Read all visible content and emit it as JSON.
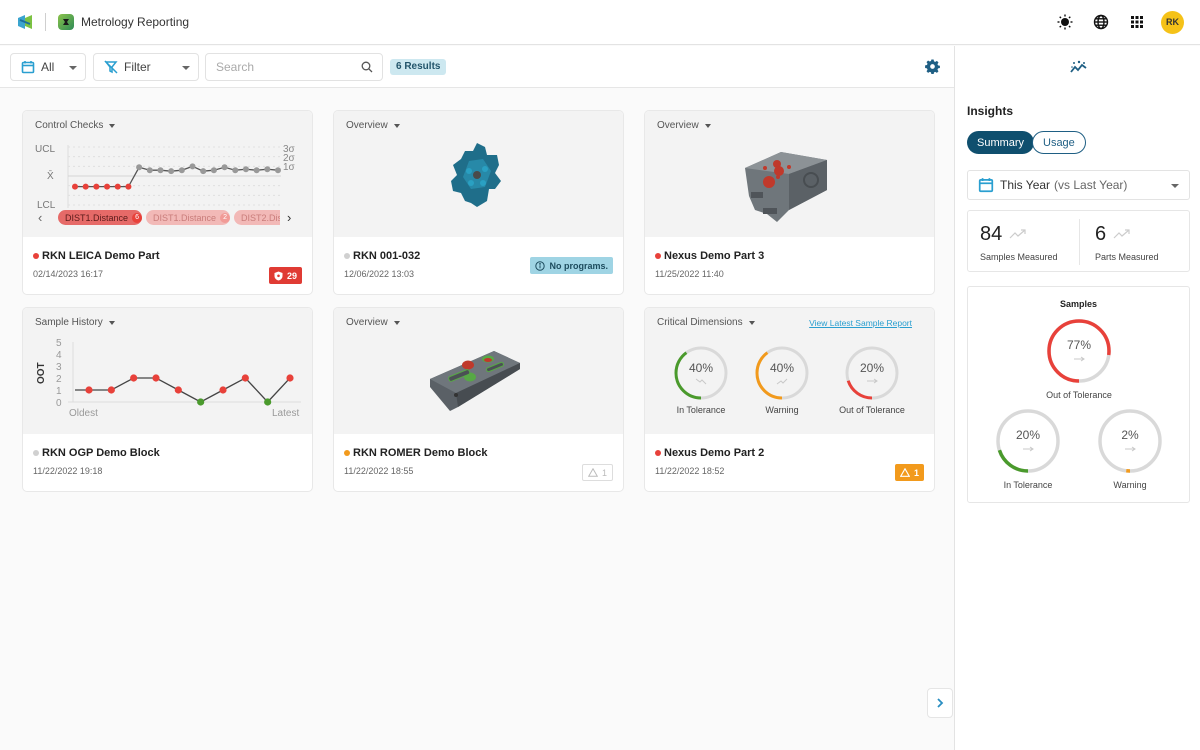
{
  "header": {
    "app_title": "Metrology Reporting",
    "avatar_initials": "RK",
    "icons": [
      "brand-logo-icon",
      "app-icon",
      "theme-sun-icon",
      "globe-icon",
      "apps-grid-icon"
    ]
  },
  "toolbar": {
    "date_filter": "All",
    "filter_label": "Filter",
    "search_placeholder": "Search",
    "search_value": "",
    "results_label": "6 Results"
  },
  "cards": [
    {
      "view": "Control Checks",
      "name": "RKN LEICA Demo Part",
      "status_color": "#e8413a",
      "date": "02/14/2023 16:17",
      "badge": {
        "type": "alert",
        "count": "29",
        "bg": "#e03b34",
        "color": "#ffffff"
      },
      "chart": {
        "y_labels_left": [
          "UCL",
          "X̄",
          "LCL"
        ],
        "y_labels_right": [
          "3σ",
          "2σ",
          "1σ"
        ],
        "chips": [
          {
            "label": "DIST1.Distance",
            "count": "6"
          },
          {
            "label": "DIST1.Distance",
            "count": "2"
          },
          {
            "label": "DIST2.Dis",
            "count": ""
          }
        ]
      }
    },
    {
      "view": "Overview",
      "name": "RKN 001-032",
      "status_color": "#cccccc",
      "date": "12/06/2022 13:03",
      "badge": {
        "type": "info",
        "text": "No programs."
      }
    },
    {
      "view": "Overview",
      "name": "Nexus Demo Part 3",
      "status_color": "#e8413a",
      "date": "11/25/2022 11:40"
    },
    {
      "view": "Sample History",
      "name": "RKN OGP Demo Block",
      "status_color": "#cccccc",
      "date": "11/22/2022 19:18",
      "chart": {
        "ylabel": "OOT",
        "y_ticks": [
          "0",
          "1",
          "2",
          "3",
          "4",
          "5"
        ],
        "x_start": "Oldest",
        "x_end": "Latest"
      }
    },
    {
      "view": "Overview",
      "name": "RKN ROMER Demo Block",
      "status_color": "#f29a1c",
      "date": "11/22/2022 18:55",
      "badge": {
        "type": "warning-outline",
        "count": "1"
      }
    },
    {
      "view": "Critical Dimensions",
      "link": "View Latest Sample Report",
      "name": "Nexus Demo Part 2",
      "status_color": "#e8413a",
      "date": "11/22/2022 18:52",
      "badge": {
        "type": "warning",
        "count": "1",
        "bg": "#f29a1c"
      },
      "gauges": [
        {
          "label": "In Tolerance",
          "value": "40%",
          "fraction": 0.4,
          "color": "#4a9a2c",
          "trend": "down"
        },
        {
          "label": "Warning",
          "value": "40%",
          "fraction": 0.4,
          "color": "#f29a1c",
          "trend": "up"
        },
        {
          "label": "Out of Tolerance",
          "value": "20%",
          "fraction": 0.2,
          "color": "#e8413a",
          "trend": "flat"
        }
      ]
    }
  ],
  "insights": {
    "title": "Insights",
    "tabs": [
      "Summary",
      "Usage"
    ],
    "active_tab": "Summary",
    "period": "This Year",
    "period_compare": "(vs Last Year)",
    "stats": [
      {
        "value": "84",
        "label": "Samples Measured"
      },
      {
        "value": "6",
        "label": "Parts Measured"
      }
    ],
    "samples_title": "Samples",
    "rings": [
      {
        "label": "Out of Tolerance",
        "value": "77%",
        "fraction": 0.77,
        "color": "#e8413a"
      },
      {
        "label": "In Tolerance",
        "value": "20%",
        "fraction": 0.2,
        "color": "#4a9a2c"
      },
      {
        "label": "Warning",
        "value": "2%",
        "fraction": 0.02,
        "color": "#f29a1c"
      }
    ]
  },
  "chart_data": [
    {
      "type": "line",
      "title": "Control Checks",
      "ylabels": [
        "LCL",
        "X̄",
        "UCL"
      ],
      "sigma_labels": [
        "1σ",
        "2σ",
        "3σ"
      ],
      "series": [
        {
          "name": "DIST1.Distance",
          "values": [
            -1.1,
            -1.1,
            -1.1,
            -1.1,
            -1.1,
            -1.1,
            0.9,
            0.6,
            0.6,
            0.5,
            0.6,
            1.0,
            0.5,
            0.6,
            0.9,
            0.6,
            0.7,
            0.6,
            0.7,
            0.6
          ],
          "out_of_control_points": 6
        }
      ],
      "ylim_sigma": [
        -3,
        3
      ]
    },
    {
      "type": "line",
      "title": "Sample History",
      "ylabel": "OOT",
      "xlabel_start": "Oldest",
      "xlabel_end": "Latest",
      "ylim": [
        0,
        5
      ],
      "x": [
        1,
        2,
        3,
        4,
        5,
        6,
        7,
        8,
        9,
        10
      ],
      "values": [
        1,
        1,
        2,
        2,
        1,
        0,
        1,
        2,
        0,
        2
      ]
    }
  ]
}
